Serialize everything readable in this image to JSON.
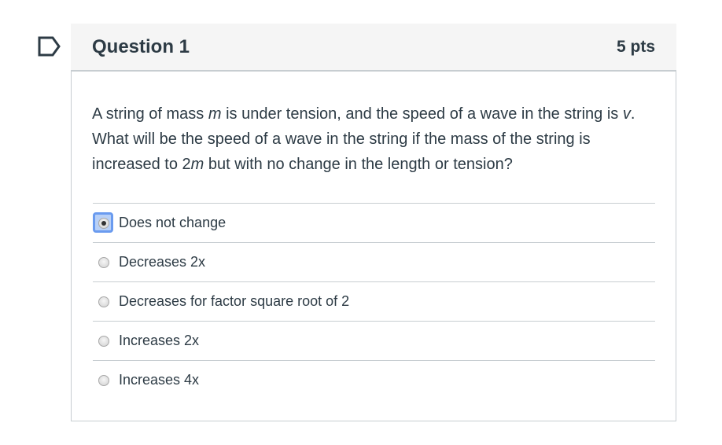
{
  "question": {
    "title": "Question 1",
    "points": "5 pts",
    "text_parts": {
      "p1": "A string of mass ",
      "m1": "m",
      "p2": " is under tension, and the speed of a wave in the string is ",
      "v": "v",
      "p3": ". What will be the speed of a wave in the string if the mass of the string is increased to 2",
      "m2": "m",
      "p4": " but with no change in the length or tension?"
    },
    "answers": [
      {
        "label": "Does not change",
        "selected": true
      },
      {
        "label": "Decreases 2x",
        "selected": false
      },
      {
        "label": "Decreases for factor square root of 2",
        "selected": false
      },
      {
        "label": "Increases 2x",
        "selected": false
      },
      {
        "label": "Increases 4x",
        "selected": false
      }
    ]
  },
  "colors": {
    "header_bg": "#f5f5f5",
    "border": "#c7cdd1",
    "text": "#2d3b45",
    "focus": "#6a9bef"
  },
  "icons": {
    "flag": "bookmark-flag-icon"
  }
}
